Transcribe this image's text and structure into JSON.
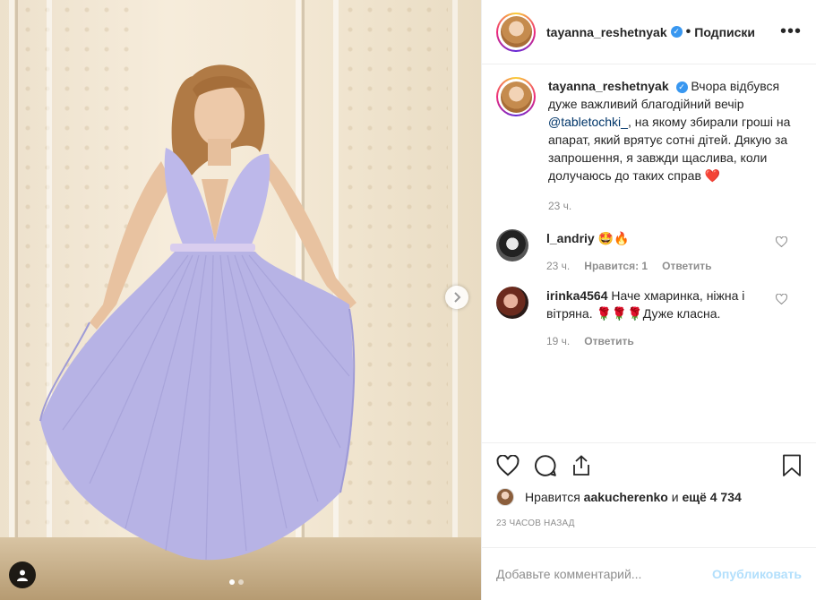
{
  "post": {
    "photo_alt": "",
    "carousel_dots": 2
  },
  "header": {
    "username": "tayanna_reshetnyak",
    "follow_label": "Подписки",
    "more_label": "•••"
  },
  "caption": {
    "username": "tayanna_reshetnyak",
    "text_before_mention": "Вчора відбувся дуже важливий благодійний вечір ",
    "mention": "@tabletochki_",
    "text_after_mention": ", на якому збирали гроші на апарат, який врятує сотні дітей. Дякую за запрошення, я завжди щаслива, коли долучаюсь до таких справ",
    "emoji": "❤️",
    "time": "23 ч."
  },
  "comments": [
    {
      "username": "l_andriy",
      "text": "🤩🔥",
      "time": "23 ч.",
      "likes_label": "Нравится: 1",
      "reply_label": "Ответить"
    },
    {
      "username": "irinka4564",
      "text": "Наче хмаринка, ніжна і вітряна. 🌹🌹🌹Дуже класна.",
      "time": "19 ч.",
      "reply_label": "Ответить"
    }
  ],
  "likes": {
    "prefix": "Нравится",
    "user": "aakucherenko",
    "middle": "и",
    "others": "ещё 4 734"
  },
  "timestamp": "23 ЧАСОВ НАЗАД",
  "add_comment": {
    "placeholder": "Добавьте комментарий...",
    "publish_label": "Опубликовать"
  },
  "colors": {
    "verified": "#3897f0",
    "mention": "#003569",
    "meta": "#8e8e8e",
    "publish_disabled": "#b2dffc",
    "dress": "#b9b6e6"
  }
}
